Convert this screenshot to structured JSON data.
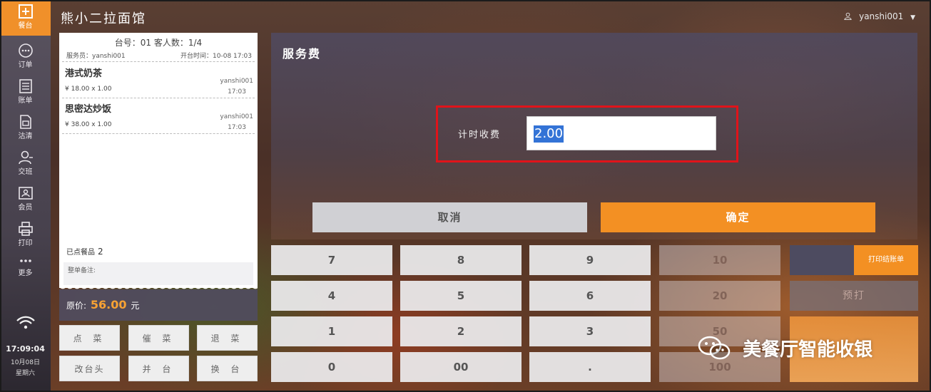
{
  "app": {
    "shop_name": "熊小二拉面馆",
    "user": "yanshi001"
  },
  "nav": {
    "items": [
      {
        "label": "餐台",
        "icon": "table-icon",
        "active": true
      },
      {
        "label": "订单",
        "icon": "order-icon"
      },
      {
        "label": "账单",
        "icon": "bill-icon"
      },
      {
        "label": "沽清",
        "icon": "soldout-icon"
      },
      {
        "label": "交班",
        "icon": "shift-icon"
      },
      {
        "label": "会员",
        "icon": "member-icon"
      },
      {
        "label": "打印",
        "icon": "printer-icon"
      },
      {
        "label": "更多",
        "icon": "more-icon"
      }
    ],
    "time": "17:09:04",
    "date": "10月08日",
    "weekday": "星期六"
  },
  "receipt": {
    "header": "台号：01  客人数：1/4",
    "waiter": "服务员：yanshi001",
    "open_time": "开台时间：10-08 17:03",
    "items": [
      {
        "name": "港式奶茶",
        "price": "¥ 18.00  x 1.00",
        "waiter": "yanshi001",
        "time": "17:03"
      },
      {
        "name": "思密达炒饭",
        "price": "¥ 38.00  x 1.00",
        "waiter": "yanshi001",
        "time": "17:03"
      }
    ],
    "ordered_label": "已点餐品",
    "ordered_count": "2",
    "note_label": "整单备注:",
    "total_label": "原价:",
    "total_value": "56.00",
    "total_unit": "元"
  },
  "actions": [
    "点 菜",
    "催 菜",
    "退 菜",
    "改台头",
    "并 台",
    "换 台"
  ],
  "modal": {
    "title": "服务费",
    "field_label": "计时收费",
    "field_value": "2.00",
    "cancel": "取消",
    "confirm": "确定"
  },
  "keypad": {
    "digits": [
      "7",
      "8",
      "9",
      "4",
      "5",
      "6",
      "1",
      "2",
      "3",
      "0",
      "00",
      "."
    ],
    "amounts": [
      "10",
      "20",
      "50",
      "100"
    ],
    "print_bill": "打印结账单",
    "preprint": "预打"
  },
  "watermark": "美餐厅智能收银"
}
